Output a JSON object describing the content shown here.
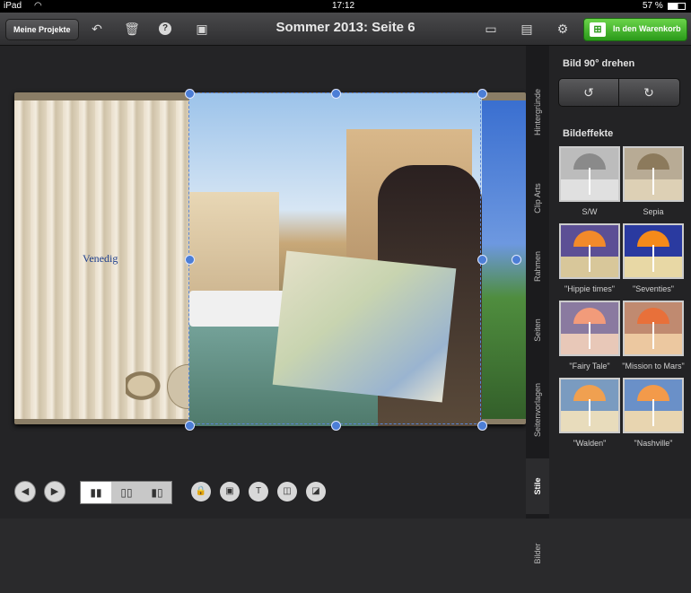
{
  "status": {
    "device": "iPad",
    "time": "17:12",
    "battery": "57 %"
  },
  "toolbar": {
    "projects_label": "Meine Projekte",
    "title": "Sommer 2013: Seite 6",
    "cart_label": "In den Warenkorb",
    "icons": [
      "undo-icon",
      "trash-icon",
      "help-icon",
      "slideshow-icon",
      "image-icon",
      "layout-icon",
      "gear-icon",
      "cart-icon"
    ]
  },
  "page": {
    "left_text": "Venedig"
  },
  "sidetabs": [
    "Hintergründe",
    "Clip Arts",
    "Rahmen",
    "Seiten",
    "Seitenvorlagen",
    "Stile",
    "Bilder"
  ],
  "panel": {
    "rotate_title": "Bild 90° drehen",
    "effects_title": "Bildeffekte",
    "effects": [
      {
        "label": "S/W",
        "sky": "#bcbcbc",
        "sand": "#e0e0e0",
        "umb": "#8a8a8a"
      },
      {
        "label": "Sepia",
        "sky": "#b8ab95",
        "sand": "#ddd0b5",
        "umb": "#8c7a5c"
      },
      {
        "label": "\"Hippie times\"",
        "sky": "#5c4f95",
        "sand": "#d8c79a",
        "umb": "#f28a2a"
      },
      {
        "label": "\"Seventies\"",
        "sky": "#2a3aa0",
        "sand": "#e8d8a5",
        "umb": "#f58a1a"
      },
      {
        "label": "\"Fairy Tale\"",
        "sky": "#8a7aa0",
        "sand": "#e8c8b8",
        "umb": "#f29b7a"
      },
      {
        "label": "\"Mission to Mars\"",
        "sky": "#c08a70",
        "sand": "#ecc8a0",
        "umb": "#e8703a"
      },
      {
        "label": "\"Walden\"",
        "sky": "#7a9bc0",
        "sand": "#e8dcbc",
        "umb": "#f0a050"
      },
      {
        "label": "\"Nashville\"",
        "sky": "#6a90c8",
        "sand": "#e8d5b0",
        "umb": "#f39a4a"
      }
    ]
  }
}
